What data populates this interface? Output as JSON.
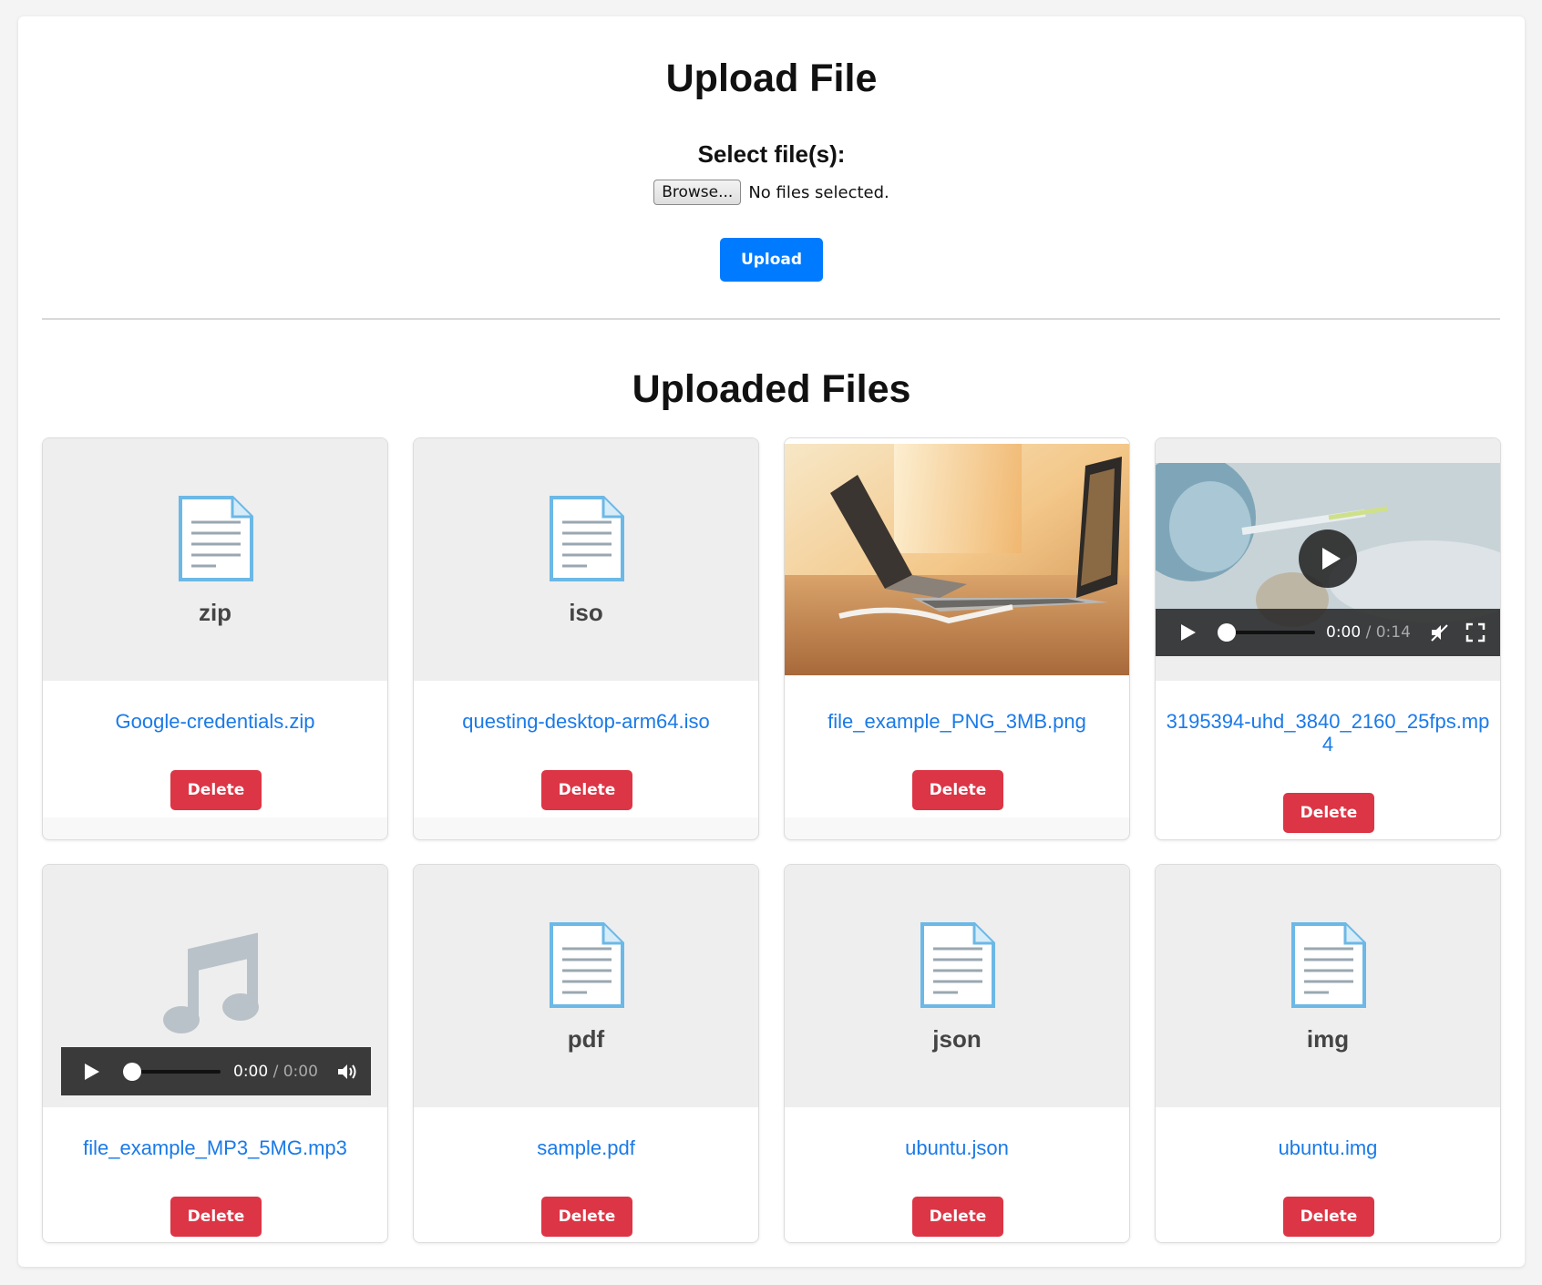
{
  "header": {
    "title": "Upload File",
    "select_label": "Select file(s):",
    "browse_label": "Browse...",
    "no_files_text": "No files selected.",
    "upload_label": "Upload"
  },
  "files_section": {
    "title": "Uploaded Files"
  },
  "colors": {
    "primary": "#007bff",
    "danger": "#dc3545",
    "link": "#1a7ae8",
    "doc_icon": "#6cb8e6"
  },
  "files": [
    {
      "name": "Google-credentials.zip",
      "ext": "zip",
      "preview": "document-icon",
      "delete_label": "Delete"
    },
    {
      "name": "questing-desktop-arm64.iso",
      "ext": "iso",
      "preview": "document-icon",
      "delete_label": "Delete"
    },
    {
      "name": "file_example_PNG_3MB.png",
      "ext": "png",
      "preview": "image-thumbnail",
      "delete_label": "Delete"
    },
    {
      "name": "3195394-uhd_3840_2160_25fps.mp4",
      "ext": "mp4",
      "preview": "video-player",
      "delete_label": "Delete",
      "video": {
        "current": "0:00",
        "duration": "0:14",
        "progress": 0
      }
    },
    {
      "name": "file_example_MP3_5MG.mp3",
      "ext": "mp3",
      "preview": "audio-player",
      "delete_label": "Delete",
      "audio": {
        "current": "0:00",
        "duration": "0:00",
        "progress": 0
      }
    },
    {
      "name": "sample.pdf",
      "ext": "pdf",
      "preview": "document-icon",
      "delete_label": "Delete"
    },
    {
      "name": "ubuntu.json",
      "ext": "json",
      "preview": "document-icon",
      "delete_label": "Delete"
    },
    {
      "name": "ubuntu.img",
      "ext": "img",
      "preview": "document-icon",
      "delete_label": "Delete"
    }
  ],
  "media": {
    "time_separator": "/"
  }
}
